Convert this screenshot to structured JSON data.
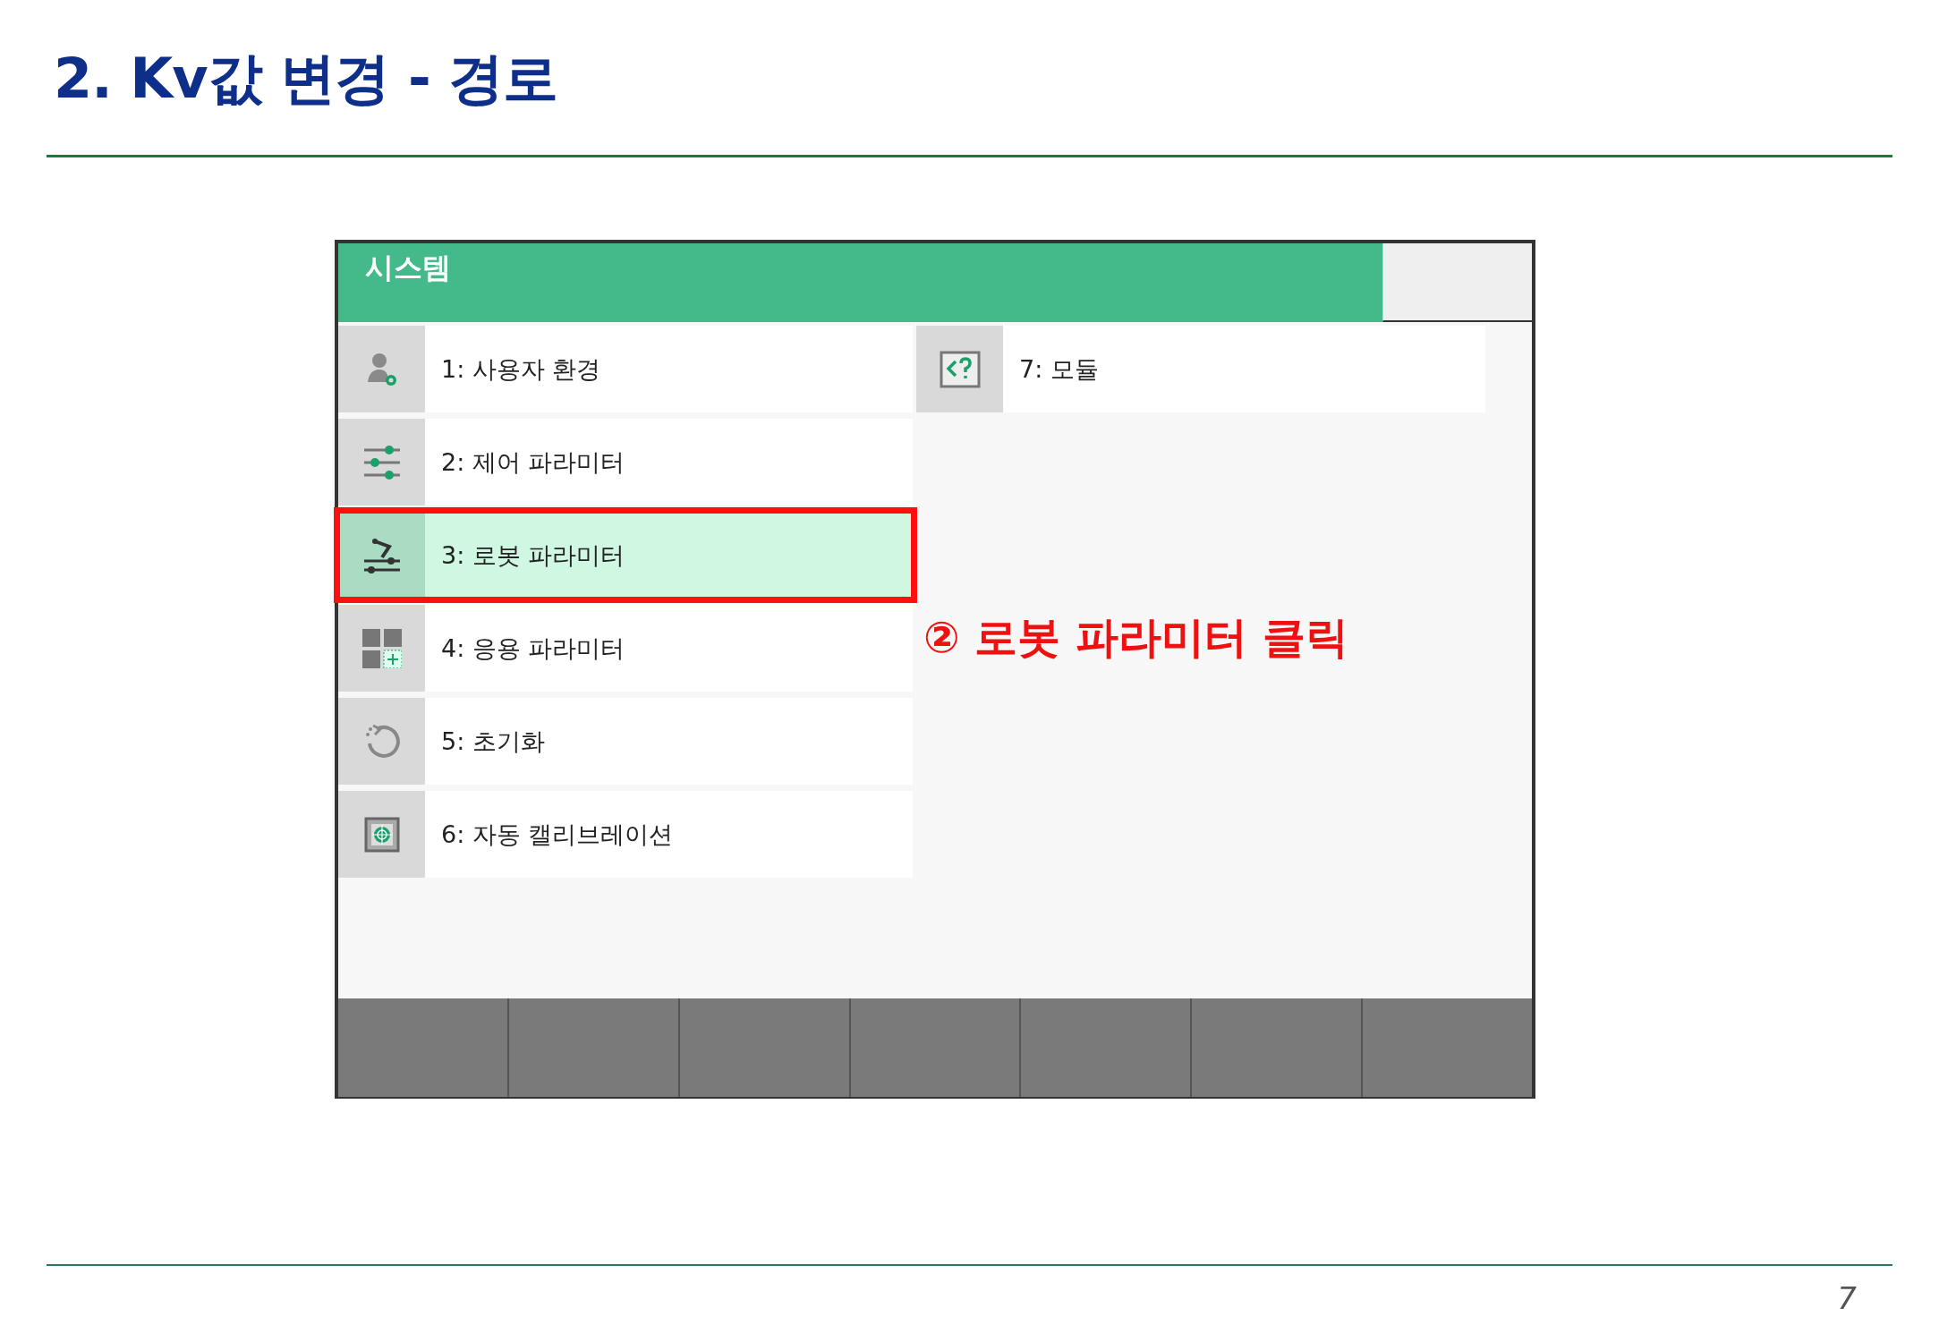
{
  "slide_title": "2. Kv값 변경 - 경로",
  "screen": {
    "header_title": "시스템",
    "menu_left": [
      {
        "label": "1: 사용자 환경",
        "selected": false,
        "highlighted": false
      },
      {
        "label": "2: 제어 파라미터",
        "selected": false,
        "highlighted": false
      },
      {
        "label": "3: 로봇 파라미터",
        "selected": true,
        "highlighted": true
      },
      {
        "label": "4: 응용 파라미터",
        "selected": false,
        "highlighted": false
      },
      {
        "label": "5: 초기화",
        "selected": false,
        "highlighted": false
      },
      {
        "label": "6: 자동 캘리브레이션",
        "selected": false,
        "highlighted": false
      }
    ],
    "menu_right": [
      {
        "label": "7: 모듈",
        "selected": false,
        "highlighted": false
      }
    ]
  },
  "annotation": "② 로봇 파라미터 클릭",
  "page_number": "7"
}
